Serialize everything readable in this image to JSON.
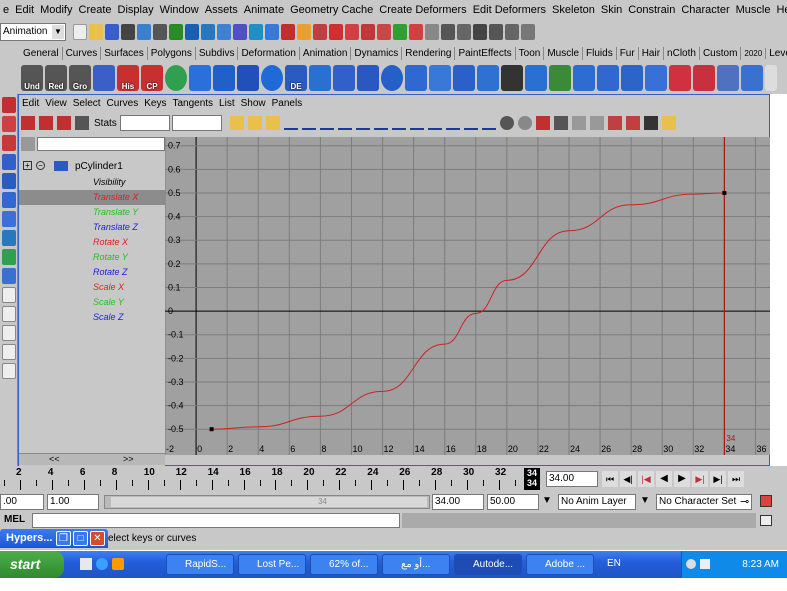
{
  "menubar": {
    "items": [
      "e",
      "Edit",
      "Modify",
      "Create",
      "Display",
      "Window",
      "Assets",
      "Animate",
      "Geometry Cache",
      "Create Deformers",
      "Edit Deformers",
      "Skeleton",
      "Skin",
      "Constrain",
      "Character",
      "Muscle",
      "Help"
    ]
  },
  "mode_select": {
    "value": "Animation"
  },
  "shelf_tabs": [
    "General",
    "Curves",
    "Surfaces",
    "Polygons",
    "Subdivs",
    "Deformation",
    "Animation",
    "Dynamics",
    "Rendering",
    "PaintEffects",
    "Toon",
    "Muscle",
    "Fluids",
    "Fur",
    "Hair",
    "nCloth",
    "Custom",
    "2020",
    "LevelToc"
  ],
  "shelf_buttons": [
    "Und",
    "Red",
    "Gro",
    "",
    "His",
    "CP",
    "",
    "",
    "",
    "",
    "",
    "",
    "DE",
    "",
    "",
    "",
    "",
    "",
    "",
    "",
    "",
    "",
    "",
    "",
    "",
    "",
    "",
    "",
    "",
    "",
    "",
    "",
    ""
  ],
  "graph_editor": {
    "menu": [
      "Edit",
      "View",
      "Select",
      "Curves",
      "Keys",
      "Tangents",
      "List",
      "Show",
      "Panels"
    ],
    "stats_label": "Stats",
    "stats_value1": "",
    "stats_value2": ""
  },
  "outliner": {
    "object": "pCylinder1",
    "channels": [
      {
        "label": "Visibility",
        "color": "#000000"
      },
      {
        "label": "Translate X",
        "color": "#e02020",
        "selected": true
      },
      {
        "label": "Translate Y",
        "color": "#20c020"
      },
      {
        "label": "Translate Z",
        "color": "#2020e0"
      },
      {
        "label": "Rotate X",
        "color": "#e02020"
      },
      {
        "label": "Rotate Y",
        "color": "#20c020"
      },
      {
        "label": "Rotate Z",
        "color": "#2020e0"
      },
      {
        "label": "Scale X",
        "color": "#e02020"
      },
      {
        "label": "Scale Y",
        "color": "#20c020"
      },
      {
        "label": "Scale Z",
        "color": "#2020e0"
      }
    ],
    "scroll_left": "<<",
    "scroll_right": ">>"
  },
  "chart_data": {
    "type": "line",
    "xlim": [
      -2,
      37
    ],
    "ylim": [
      -0.55,
      0.72
    ],
    "x_ticks": [
      -2,
      0,
      2,
      4,
      6,
      8,
      10,
      12,
      14,
      16,
      18,
      20,
      22,
      24,
      26,
      28,
      30,
      32,
      34,
      36
    ],
    "x_tick_labels": [
      "-2",
      "0",
      "2",
      "4",
      "6",
      "8",
      "10",
      "12",
      "14",
      "16",
      "18",
      "20",
      "22",
      "24",
      "26",
      "28",
      "30",
      "32",
      "34",
      "36"
    ],
    "y_ticks": [
      0.7,
      0.6,
      0.5,
      0.4,
      0.3,
      0.2,
      0.1,
      0,
      -0.1,
      -0.2,
      -0.3,
      -0.4,
      -0.5
    ],
    "y_tick_labels": [
      "0.7",
      "0.6",
      "0.5",
      "0.4",
      "0.3",
      "0.2",
      "0.1",
      "0",
      "-0.1",
      "-0.2",
      "-0.3",
      "-0.4",
      "-0.5"
    ],
    "series": [
      {
        "color": "#cc2222",
        "x": [
          1,
          4,
          8,
          12,
          16,
          18,
          20,
          24,
          28,
          32,
          34
        ],
        "y": [
          -0.5,
          -0.49,
          -0.445,
          -0.34,
          -0.14,
          -0.01,
          0.13,
          0.34,
          0.45,
          0.495,
          0.5
        ]
      }
    ],
    "keys": [
      {
        "x": 1,
        "y": -0.5
      },
      {
        "x": 34,
        "y": 0.5
      }
    ],
    "current_time": 34,
    "current_time_label": "34",
    "grid": true
  },
  "timeline": {
    "ticks": [
      "2",
      "4",
      "6",
      "8",
      "10",
      "12",
      "14",
      "16",
      "18",
      "20",
      "22",
      "24",
      "26",
      "28",
      "30",
      "32",
      "34"
    ],
    "current_frame_top": "34",
    "current_frame_bottom": "34",
    "current_field": "34.00"
  },
  "range": {
    "start_outer": ".00",
    "start_inner": "1.00",
    "slider_label": "34",
    "end_inner": "34.00",
    "end_outer": "50.00",
    "anim_layer": "No Anim Layer",
    "character_set": "No Character Set"
  },
  "mel": {
    "label": "MEL"
  },
  "help": {
    "text": "elect keys or curves"
  },
  "hyper": {
    "label": "Hypers..."
  },
  "taskbar": {
    "start": "start",
    "tasks": [
      "RapidS...",
      "Lost Pe...",
      "62% of...",
      "أو مع...",
      "Autode...",
      "Adobe ..."
    ],
    "language": "EN",
    "time": "8:23 AM"
  }
}
